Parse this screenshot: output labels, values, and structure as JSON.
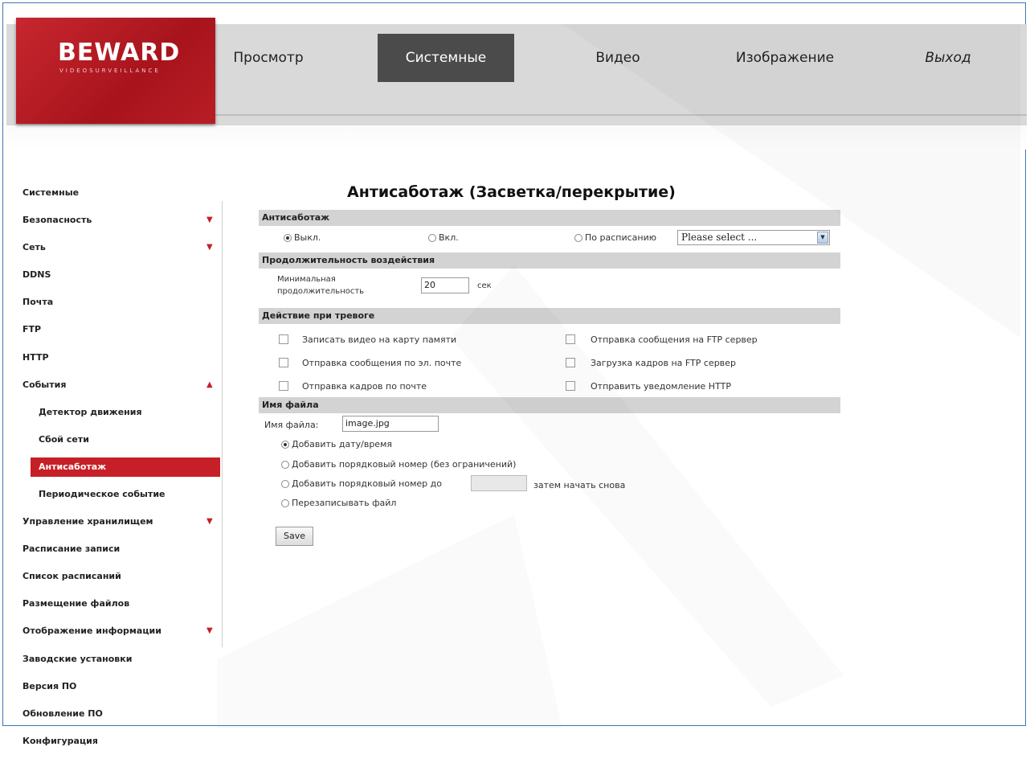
{
  "logo": {
    "text": "BEWARD",
    "subtitle": "VIDEOSURVEILLANCE"
  },
  "nav": {
    "tabs": [
      {
        "label": "Просмотр"
      },
      {
        "label": "Системные",
        "active": true
      },
      {
        "label": "Видео"
      },
      {
        "label": "Изображение"
      },
      {
        "label": "Выход"
      }
    ]
  },
  "sidebar": {
    "items": [
      {
        "label": "Системные"
      },
      {
        "label": "Безопасность",
        "arrow": "▼"
      },
      {
        "label": "Сеть",
        "arrow": "▼"
      },
      {
        "label": "DDNS"
      },
      {
        "label": "Почта"
      },
      {
        "label": "FTP"
      },
      {
        "label": "HTTP"
      },
      {
        "label": "События",
        "arrow": "▲"
      },
      {
        "label": "Детектор движения"
      },
      {
        "label": "Сбой сети"
      },
      {
        "label": "Антисаботаж"
      },
      {
        "label": "Периодическое событие"
      },
      {
        "label": "Управление хранилищем",
        "arrow": "▼"
      },
      {
        "label": "Расписание записи"
      },
      {
        "label": "Список расписаний"
      },
      {
        "label": "Размещение файлов"
      },
      {
        "label": "Отображение информации",
        "arrow": "▼"
      },
      {
        "label": "Заводские установки"
      },
      {
        "label": "Версия ПО"
      },
      {
        "label": "Обновление ПО"
      },
      {
        "label": "Конфигурация"
      }
    ]
  },
  "main": {
    "title": "Антисаботаж (Засветка/перекрытие)",
    "antisabotage": {
      "section": "Антисаботаж",
      "off": "Выкл.",
      "on": "Вкл.",
      "schedule": "По расписанию",
      "select_value": "Please select ...",
      "selected": "off"
    },
    "duration": {
      "section": "Продолжительность воздействия",
      "label_line1": "Минимальная",
      "label_line2": "продолжительность",
      "value": "20",
      "unit": "сек"
    },
    "actions": {
      "section": "Действие при тревоге",
      "left": [
        "Записать видео на карту памяти",
        "Отправка сообщения по эл. почте",
        "Отправка кадров по почте"
      ],
      "right": [
        "Отправка сообщения на FTP сервер",
        "Загрузка кадров на FTP сервер",
        "Отправить уведомление HTTP"
      ]
    },
    "filename": {
      "section": "Имя файла",
      "label": "Имя файла:",
      "value": "image.jpg",
      "opt1": "Добавить дату/время",
      "opt2": "Добавить порядковый номер (без ограничений)",
      "opt3": "Добавить порядковый номер до",
      "opt3_value": "",
      "opt3_suffix": "затем начать снова",
      "opt4": "Перезаписывать файл",
      "selected": "opt1"
    },
    "save_label": "Save"
  },
  "colors": {
    "accent": "#c61f27",
    "active_tab": "#4b4b4b",
    "section_bg": "#d3d3d3"
  }
}
